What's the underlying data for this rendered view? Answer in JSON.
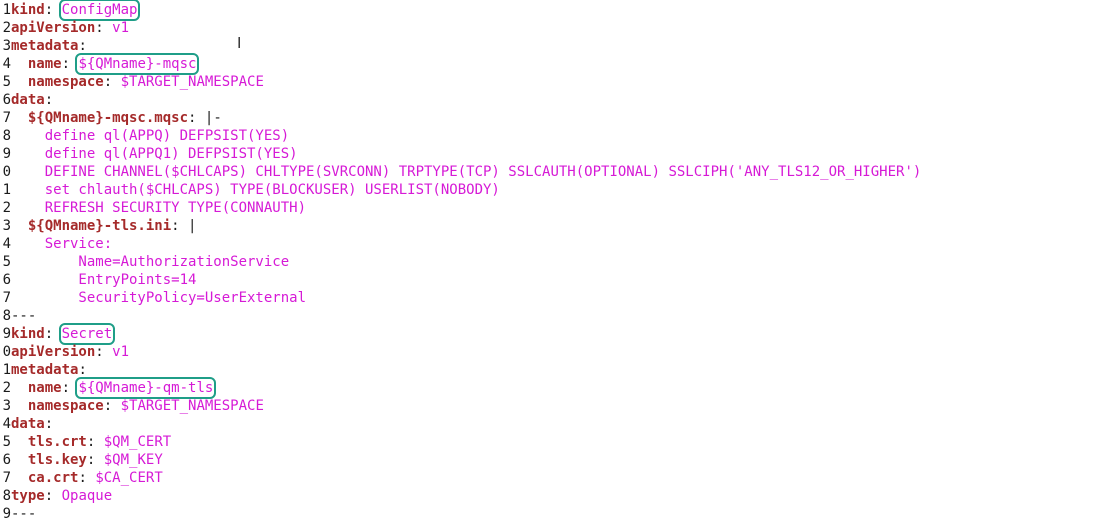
{
  "lines": [
    {
      "num": "1",
      "key": "kind",
      "value": "ConfigMap"
    },
    {
      "num": "2",
      "key": "apiVersion",
      "value": "v1"
    },
    {
      "num": "3",
      "key": "metadata"
    },
    {
      "num": "4",
      "indent": "  ",
      "key": "name",
      "value": "${QMname}-mqsc"
    },
    {
      "num": "5",
      "indent": "  ",
      "key": "namespace",
      "value": "$TARGET_NAMESPACE"
    },
    {
      "num": "6",
      "key": "data"
    },
    {
      "num": "7",
      "indent": "  ",
      "key": "${QMname}-mqsc.mqsc",
      "value": "|-"
    },
    {
      "num": "8",
      "text": "    define ql(APPQ) DEFPSIST(YES)"
    },
    {
      "num": "9",
      "text": "    define ql(APPQ1) DEFPSIST(YES)"
    },
    {
      "num": "0",
      "text": "    DEFINE CHANNEL($CHLCAPS) CHLTYPE(SVRCONN) TRPTYPE(TCP) SSLCAUTH(OPTIONAL) SSLCIPH('ANY_TLS12_OR_HIGHER')"
    },
    {
      "num": "1",
      "text": "    set chlauth($CHLCAPS) TYPE(BLOCKUSER) USERLIST(NOBODY)"
    },
    {
      "num": "2",
      "text": "    REFRESH SECURITY TYPE(CONNAUTH)"
    },
    {
      "num": "3",
      "indent": "  ",
      "key": "${QMname}-tls.ini",
      "value": "|"
    },
    {
      "num": "4",
      "text": "    Service:"
    },
    {
      "num": "5",
      "text": "        Name=AuthorizationService"
    },
    {
      "num": "6",
      "text": "        EntryPoints=14"
    },
    {
      "num": "7",
      "text": "        SecurityPolicy=UserExternal"
    },
    {
      "num": "8",
      "text": "---"
    },
    {
      "num": "9",
      "key": "kind",
      "value": "Secret"
    },
    {
      "num": "0",
      "key": "apiVersion",
      "value": "v1"
    },
    {
      "num": "1",
      "key": "metadata"
    },
    {
      "num": "2",
      "indent": "  ",
      "key": "name",
      "value": "${QMname}-qm-tls"
    },
    {
      "num": "3",
      "indent": "  ",
      "key": "namespace",
      "value": "$TARGET_NAMESPACE"
    },
    {
      "num": "4",
      "key": "data"
    },
    {
      "num": "5",
      "indent": "  ",
      "key": "tls.crt",
      "value": "$QM_CERT"
    },
    {
      "num": "6",
      "indent": "  ",
      "key": "tls.key",
      "value": "$QM_KEY"
    },
    {
      "num": "7",
      "indent": "  ",
      "key": "ca.crt",
      "value": "$CA_CERT"
    },
    {
      "num": "8",
      "key": "type",
      "value": "Opaque"
    },
    {
      "num": "9",
      "text": "---"
    }
  ],
  "highlighted_lines": [
    0,
    3,
    18,
    21
  ],
  "cursor_glyph": "I",
  "colors": {
    "key": "#a52a2a",
    "value": "#d61ad6",
    "highlight": "#1f9e88",
    "gutter": "#1a1a1a"
  }
}
